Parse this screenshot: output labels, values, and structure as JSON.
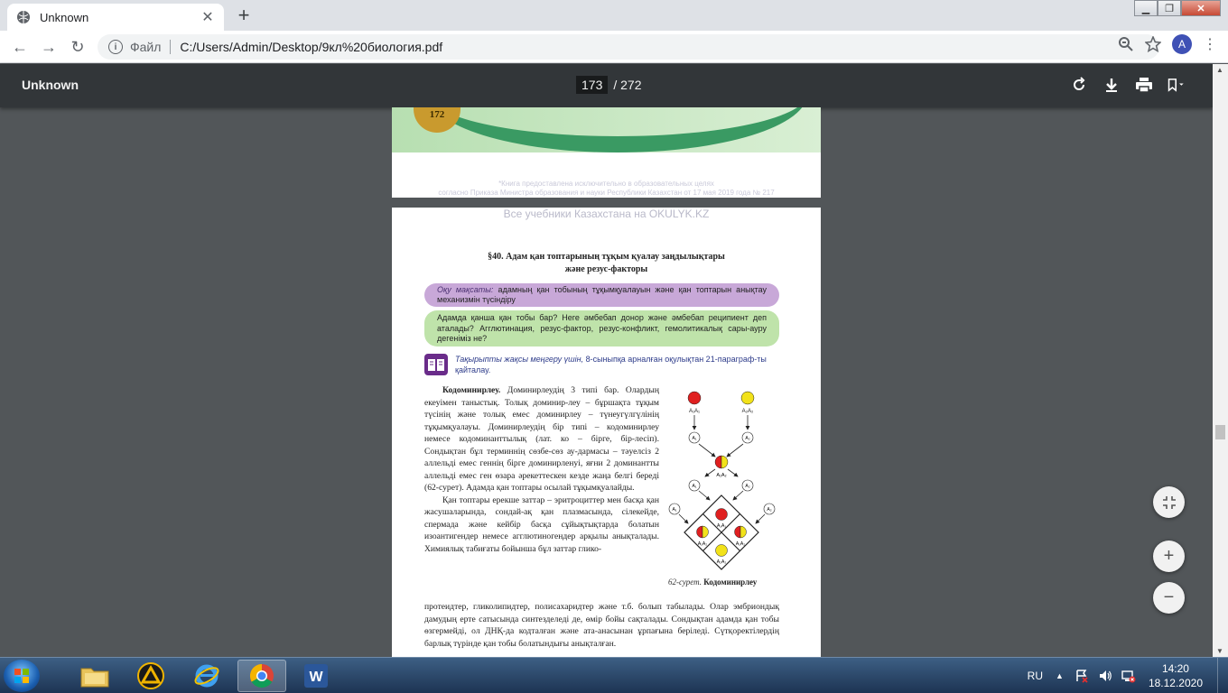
{
  "browser": {
    "tab_title": "Unknown",
    "scheme_label": "Файл",
    "url": "C:/Users/Admin/Desktop/9кл%20биология.pdf",
    "avatar_letter": "A"
  },
  "pdf": {
    "title": "Unknown",
    "current_page": "173",
    "total_pages": "/ 272"
  },
  "prev_page": {
    "page_number": "172",
    "disclaimer_line1": "*Книга предоставлена исключительно в образовательных целях",
    "disclaimer_line2": "согласно Приказа Министра образования и науки Республики Казахстан от 17 мая 2019 года № 217"
  },
  "page": {
    "watermark": "Все учебники Казахстана на OKULYK.KZ",
    "title_line1": "§40. Адам қан топтарының тұқым қуалау заңдылықтары",
    "title_line2": "және резус-факторы",
    "goal_label": "Оқу мақсаты:",
    "goal_text": " адамның қан тобының тұқымқуалауын және қан топтарын анықтау механизмін түсіндіру",
    "questions": "Адамда қанша қан тобы бар? Неге әмбебап донор және әмбебап реципиент деп аталады? Агглютинация, резус-фактор, резус-конфликт, гемолитикалық сары-ауру дегеніміз не?",
    "repeat_label": "Тақырыпты жақсы меңгеру үшін,",
    "repeat_text": " 8-сыныпқа арналған оқулықтан 21-параграф-ты қайталау.",
    "para1_bold": "Кодоминирлеу.",
    "para1": " Доминирлеудің 3 типі бар. Олардың екеуімен таныстық. Толық доминир-леу – бұршақта тұқым түсінің және толық емес доминирлеу – түнеугүлгүлінің тұқымқуалауы. Доминирлеудің бір типі – кодоминирлеу немесе кодоминанттылық (лат. ко – бірге, бір-лесіп). Сондықтан бұл терминнің сөзбе-сөз ау-дармасы – тәуелсіз 2 аллельді емес геннің бірге доминирленуі, яғни 2 доминантты аллельді емес ген өзара әрекеттескен кезде жаңа белгі береді (62-сурет). Адамда қан топтары осылай тұқымқуалайды.",
    "para2": "Қан топтары ерекше заттар – эритроциттер мен басқа қан жасушаларында, сондай-ақ қан плазмасында, сілекейде, спермада және кейбір басқа сұйықтықтарда болатын изоантигендер немесе агглютиногендер арқылы анықталады. Химиялық табиғаты бойынша бұл заттар глико-",
    "para3": "протеидтер, гликолипидтер, полисахаридтер және т.б. болып табылады. Олар эмбриондық дамудың ерте сатысында синтезделеді де, өмір бойы сақталады. Сондықтан адамда қан тобы өзгермейді, ол ДНҚ-да кодталған және ата-анасынан ұрпағына беріледі. Сүтқоректілердің барлық түрінде қан тобы болатындығы анықталған.",
    "caption_num": "62-сурет.",
    "caption_text": " Кодоминирлеу",
    "fig_labels": {
      "a1a1": "A₁A₁",
      "a2a2": "A₂A₂",
      "a1": "A₁",
      "a2": "A₂",
      "a1a2": "A₁A₂"
    }
  },
  "taskbar": {
    "language": "RU",
    "time": "14:20",
    "date": "18.12.2020"
  },
  "colors": {
    "red_allele": "#e02020",
    "yellow_allele": "#f2e21a",
    "goal_bg": "#c8a8d8",
    "questions_bg": "#bfe3aa"
  }
}
